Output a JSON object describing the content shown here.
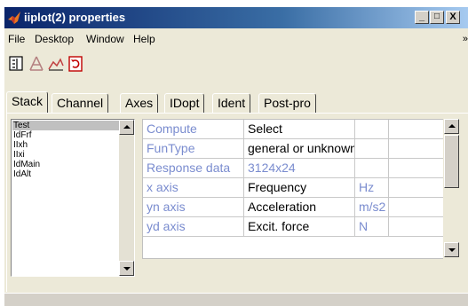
{
  "window": {
    "title": "iiplot(2) properties",
    "controls": [
      "_",
      "□",
      "X"
    ]
  },
  "menu": {
    "items": [
      "File",
      "Desktop",
      "Window",
      "Help"
    ],
    "overflow_arrow": "»"
  },
  "toolbar": {
    "buttons": [
      "stack-view-icon",
      "axes-icon",
      "line-plot-icon",
      "refresh-icon"
    ]
  },
  "tabs": [
    "Stack",
    "Channel",
    "Axes",
    "IDopt",
    "Ident",
    "Post-pro"
  ],
  "active_tab": "Stack",
  "stack_list": {
    "items": [
      "Test",
      "IdFrf",
      "IIxh",
      "IIxi",
      "IdMain",
      "IdAlt"
    ],
    "selected": "Test"
  },
  "properties": {
    "rows": [
      {
        "key": "Compute",
        "value": "Select",
        "unit": ""
      },
      {
        "key": "FunType",
        "value": "general or unknown",
        "unit": ""
      },
      {
        "key": "Response data",
        "value": "3124x24",
        "unit": ""
      },
      {
        "key": "x axis",
        "value": "Frequency",
        "unit": "Hz"
      },
      {
        "key": "yn axis",
        "value": "Acceleration",
        "unit": "m/s2"
      },
      {
        "key": "yd axis",
        "value": "Excit. force",
        "unit": "N"
      }
    ]
  },
  "colors": {
    "title_bar_start": "#0a246a",
    "title_bar_end": "#a6caf0",
    "key_text": "#7a8ccf",
    "face": "#ece9d8"
  }
}
